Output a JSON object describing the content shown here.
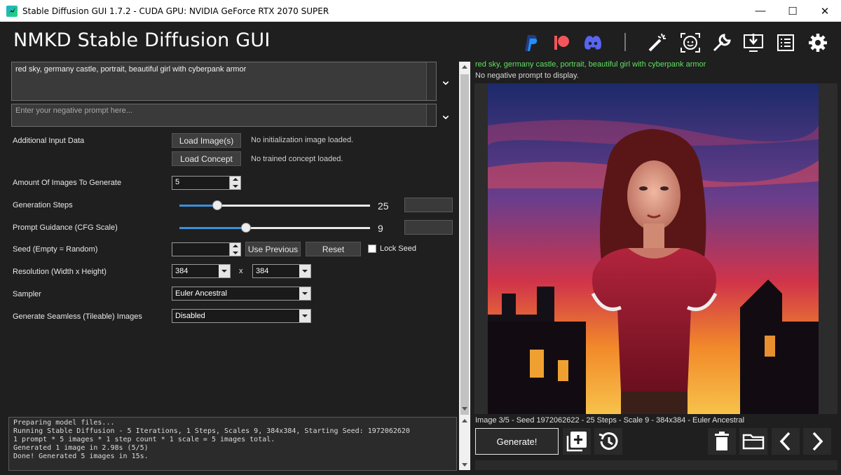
{
  "window": {
    "title": "Stable Diffusion GUI 1.7.2 - CUDA GPU: NVIDIA GeForce RTX 2070 SUPER",
    "minimize": "—",
    "maximize": "☐",
    "close": "✕"
  },
  "header": {
    "app_title": "NMKD Stable Diffusion GUI",
    "icons": [
      "paypal-icon",
      "patreon-icon",
      "discord-icon",
      "magic-wand-icon",
      "face-restore-icon",
      "wrench-icon",
      "install-icon",
      "log-icon",
      "gear-icon"
    ]
  },
  "prompt": {
    "value": "red sky, germany castle, portrait,  beautiful girl with cyberpank armor"
  },
  "negative_prompt": {
    "placeholder": "Enter your negative prompt here..."
  },
  "form": {
    "additional_input_label": "Additional Input Data",
    "load_images_button": "Load Image(s)",
    "load_images_status": "No initialization image loaded.",
    "load_concept_button": "Load Concept",
    "load_concept_status": "No trained concept loaded.",
    "amount_label": "Amount Of Images To Generate",
    "amount_value": "5",
    "steps_label": "Generation Steps",
    "steps_value": "25",
    "steps_level": 0.2,
    "cfg_label": "Prompt Guidance (CFG Scale)",
    "cfg_value": "9",
    "cfg_level": 0.35,
    "seed_label": "Seed (Empty = Random)",
    "seed_value": "",
    "use_previous_button": "Use Previous",
    "reset_button": "Reset",
    "lock_seed_label": "Lock Seed",
    "resolution_label": "Resolution (Width x Height)",
    "width_value": "384",
    "resolution_sep": "x",
    "height_value": "384",
    "sampler_label": "Sampler",
    "sampler_value": "Euler Ancestral",
    "seamless_label": "Generate Seamless (Tileable) Images",
    "seamless_value": "Disabled"
  },
  "log": {
    "lines": [
      "Preparing model files...",
      "Running Stable Diffusion - 5 Iterations, 1 Steps, Scales 9, 384x384, Starting Seed: 1972062620",
      "1 prompt * 5 images * 1 step count * 1 scale = 5 images total.",
      "Generated 1 image in 2.98s (5/5)",
      "Done! Generated 5 images in 15s."
    ]
  },
  "preview": {
    "prompt": "red sky, germany castle, portrait,  beautiful girl with cyberpank armor",
    "negative": "No negative prompt to display.",
    "info": "Image 3/5  - Seed 1972062622 - 25 Steps - Scale 9 - 384x384 - Euler Ancestral"
  },
  "bottom": {
    "generate_button": "Generate!",
    "icons": [
      "add-queue-icon",
      "history-icon",
      "delete-icon",
      "folder-icon",
      "prev-icon",
      "next-icon"
    ]
  },
  "colors": {
    "background": "#1f1f1f",
    "prompt_green": "#5fe05f",
    "paypal": "#1e90ff",
    "patreon": "#f2565b",
    "discord": "#5865f2"
  }
}
